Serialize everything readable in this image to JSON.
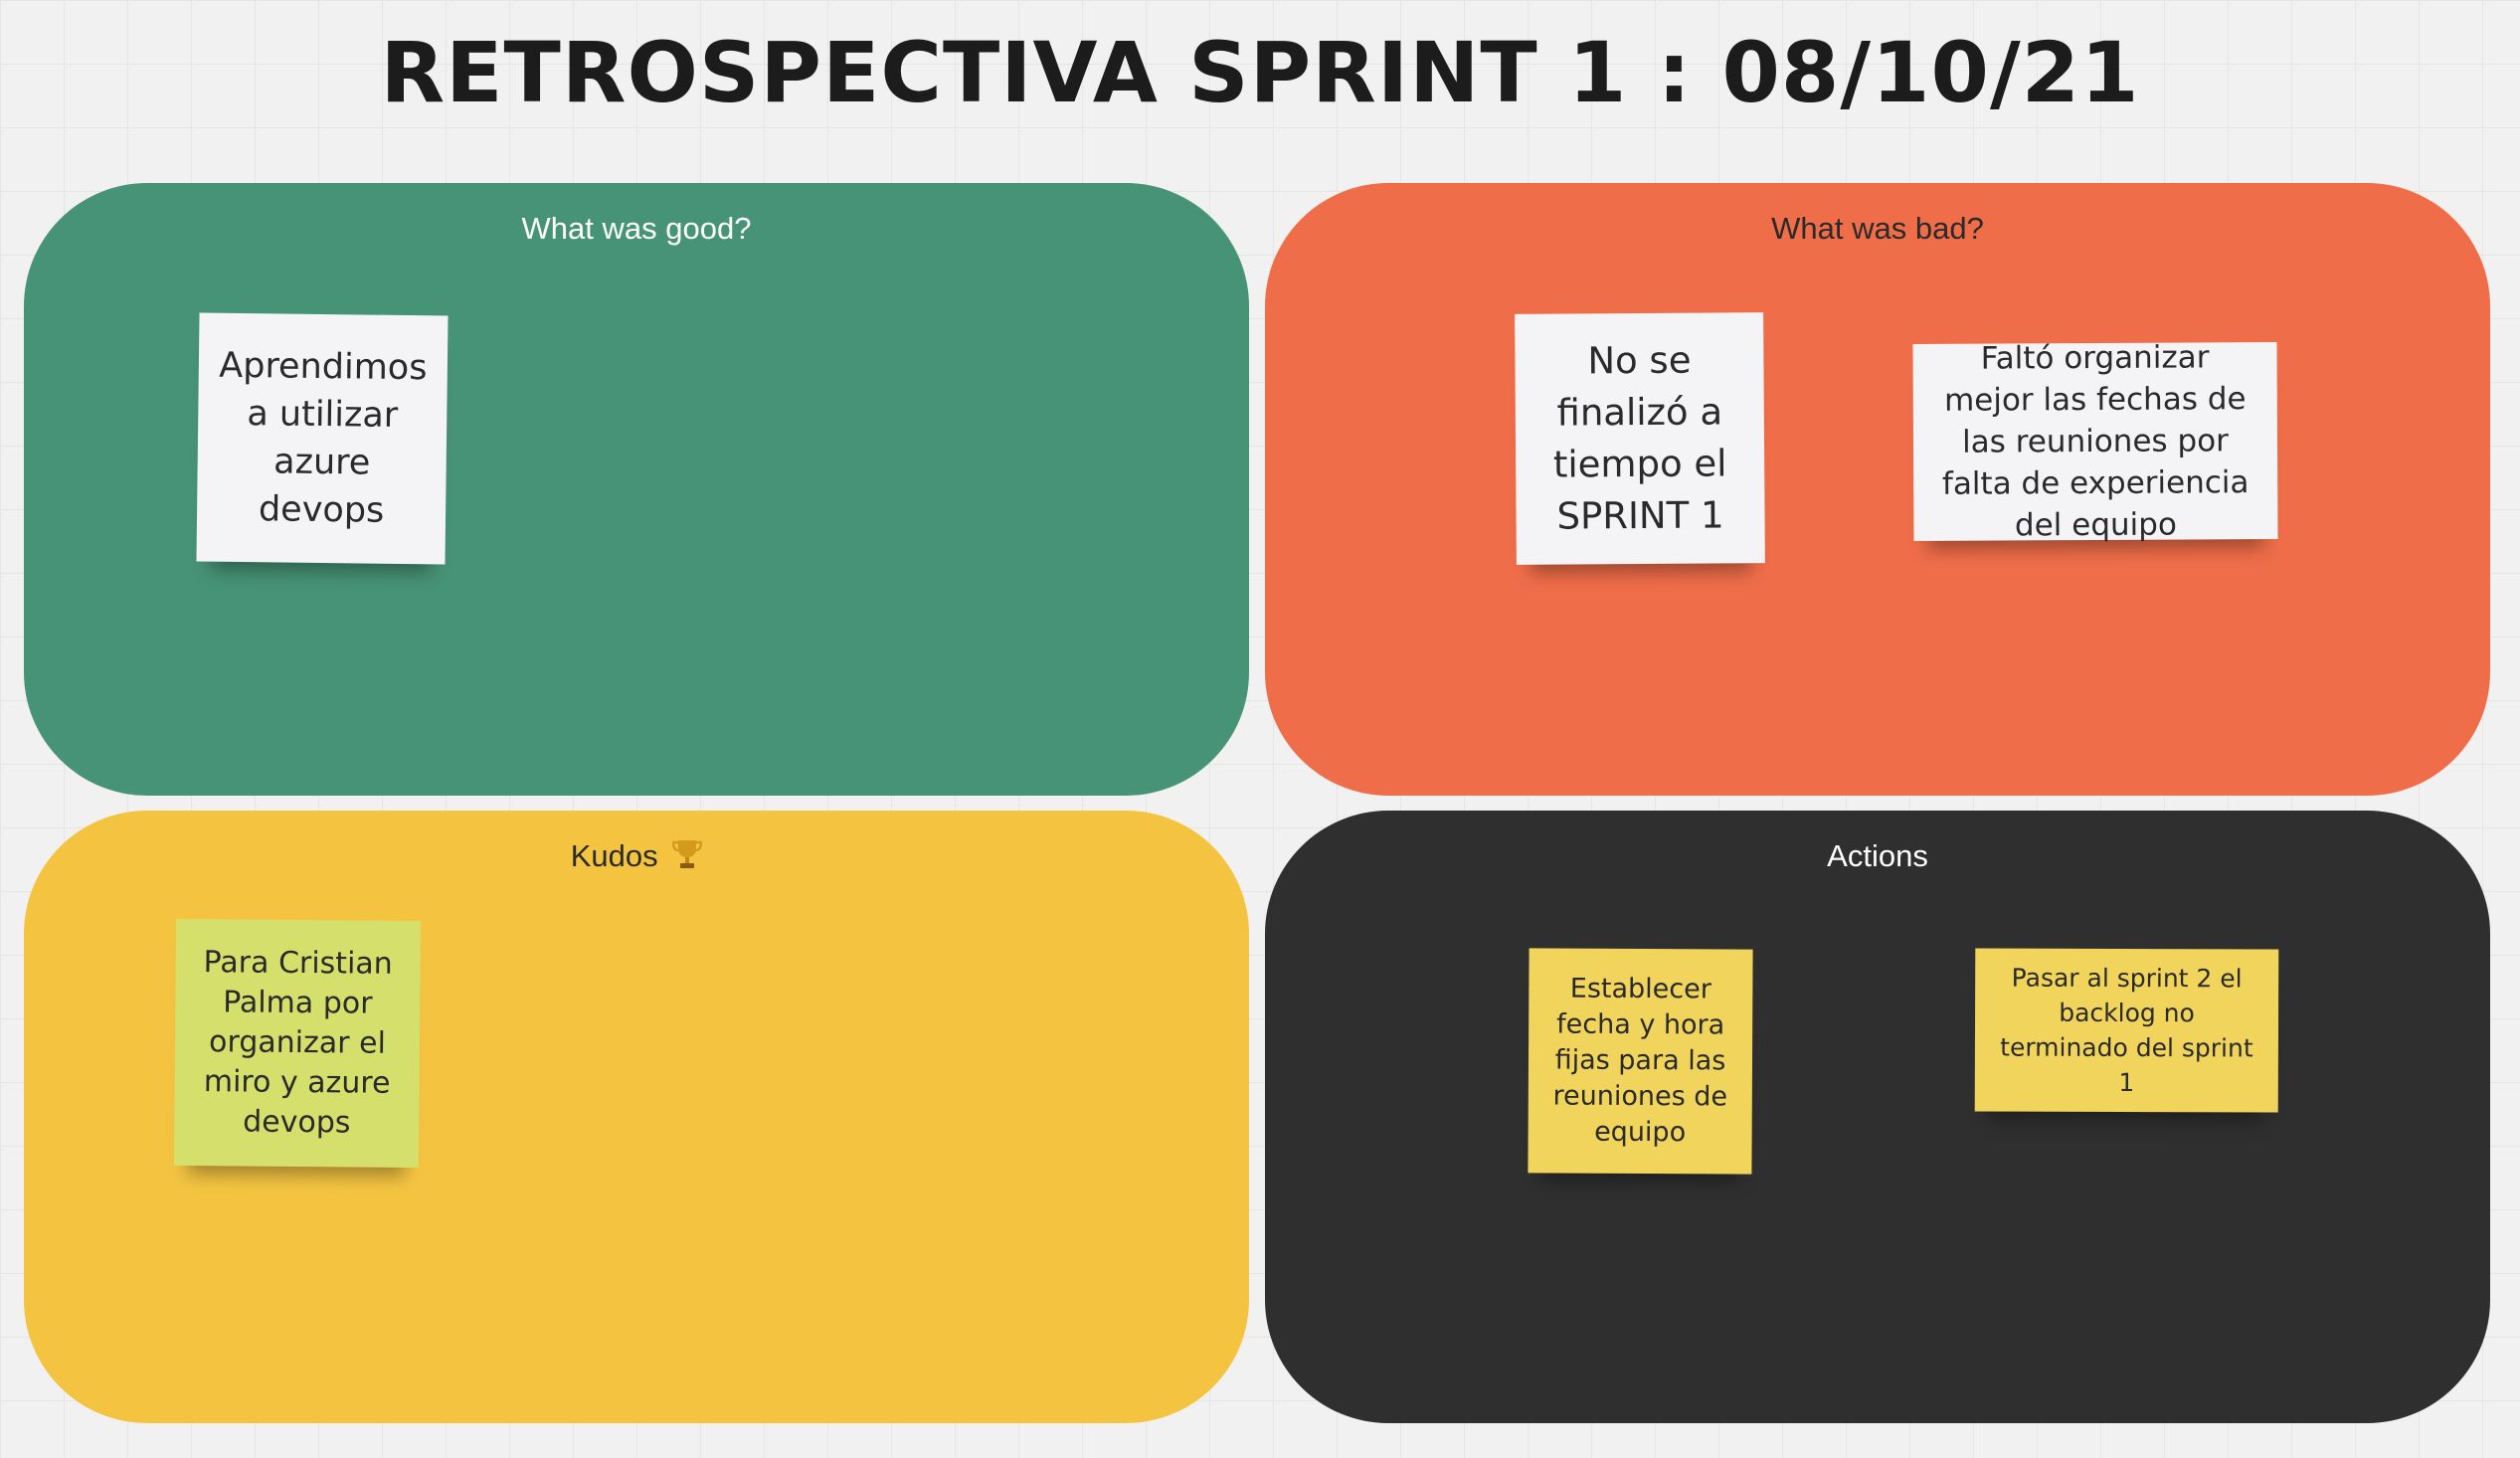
{
  "board": {
    "title": "RETROSPECTIVA SPRINT 1 : 08/10/21"
  },
  "panels": {
    "good": {
      "label": "What was good?",
      "color": "#479377",
      "notes": [
        {
          "text": "Aprendimos a utilizar azure devops",
          "color": "#f4f4f6"
        }
      ]
    },
    "bad": {
      "label": "What was bad?",
      "color": "#ef6d49",
      "notes": [
        {
          "text": "No se finalizó a tiempo el SPRINT 1",
          "color": "#f4f4f6"
        },
        {
          "text": "Faltó organizar mejor las fechas de las reuniones por falta de experiencia del equipo",
          "color": "#f4f4f6"
        }
      ]
    },
    "kudos": {
      "label": "Kudos",
      "icon": "trophy-icon",
      "color": "#f4c441",
      "notes": [
        {
          "text": "Para Cristian Palma por organizar el miro y azure devops",
          "color": "#d4e06b"
        }
      ]
    },
    "actions": {
      "label": "Actions",
      "color": "#2f2f2f",
      "notes": [
        {
          "text": "Establecer fecha y hora fijas para las reuniones de equipo",
          "color": "#f1d45c"
        },
        {
          "text": "Pasar al sprint 2 el backlog no terminado del sprint 1",
          "color": "#f1d45c"
        }
      ]
    }
  }
}
